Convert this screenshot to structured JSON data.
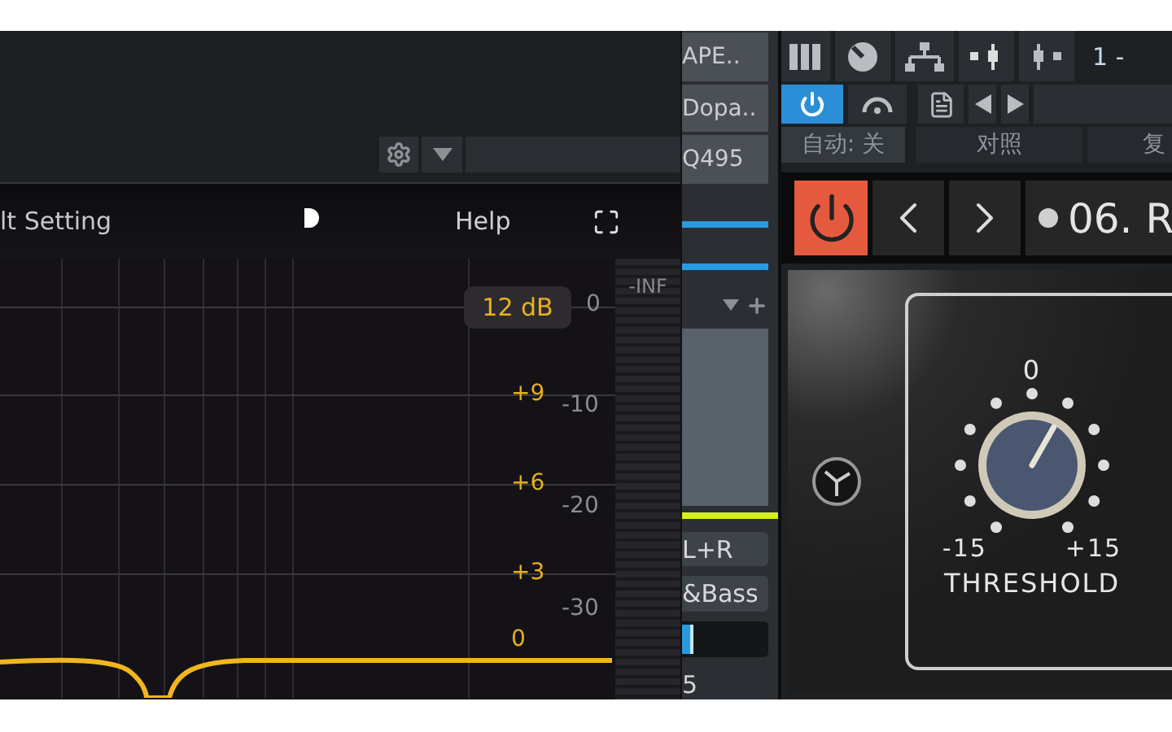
{
  "plugin_bar": {
    "preset_label": "lt Setting",
    "help": "Help"
  },
  "eq_graph": {
    "range_badge": "12 dB",
    "gain_labels": [
      "+9",
      "+6",
      "+3",
      "0"
    ],
    "meter_scale": [
      "0",
      "-10",
      "-20",
      "-30"
    ],
    "meter_top": "-INF"
  },
  "insert_list": {
    "items": [
      "APE..",
      "Dopa..",
      "Q495"
    ]
  },
  "channel": {
    "input": "L+R",
    "preset": "&Bass",
    "level": 0.1,
    "value": "5"
  },
  "toolbar": {
    "position": "1 - ",
    "power_on": true,
    "automation": "自动: 关",
    "compare": "对照",
    "copy": "复"
  },
  "plugin": {
    "power_on": true,
    "preset": "06. R",
    "knob": {
      "center": "0",
      "min": "-15",
      "max": "+15",
      "label": "THRESHOLD",
      "level": 0.61
    }
  }
}
